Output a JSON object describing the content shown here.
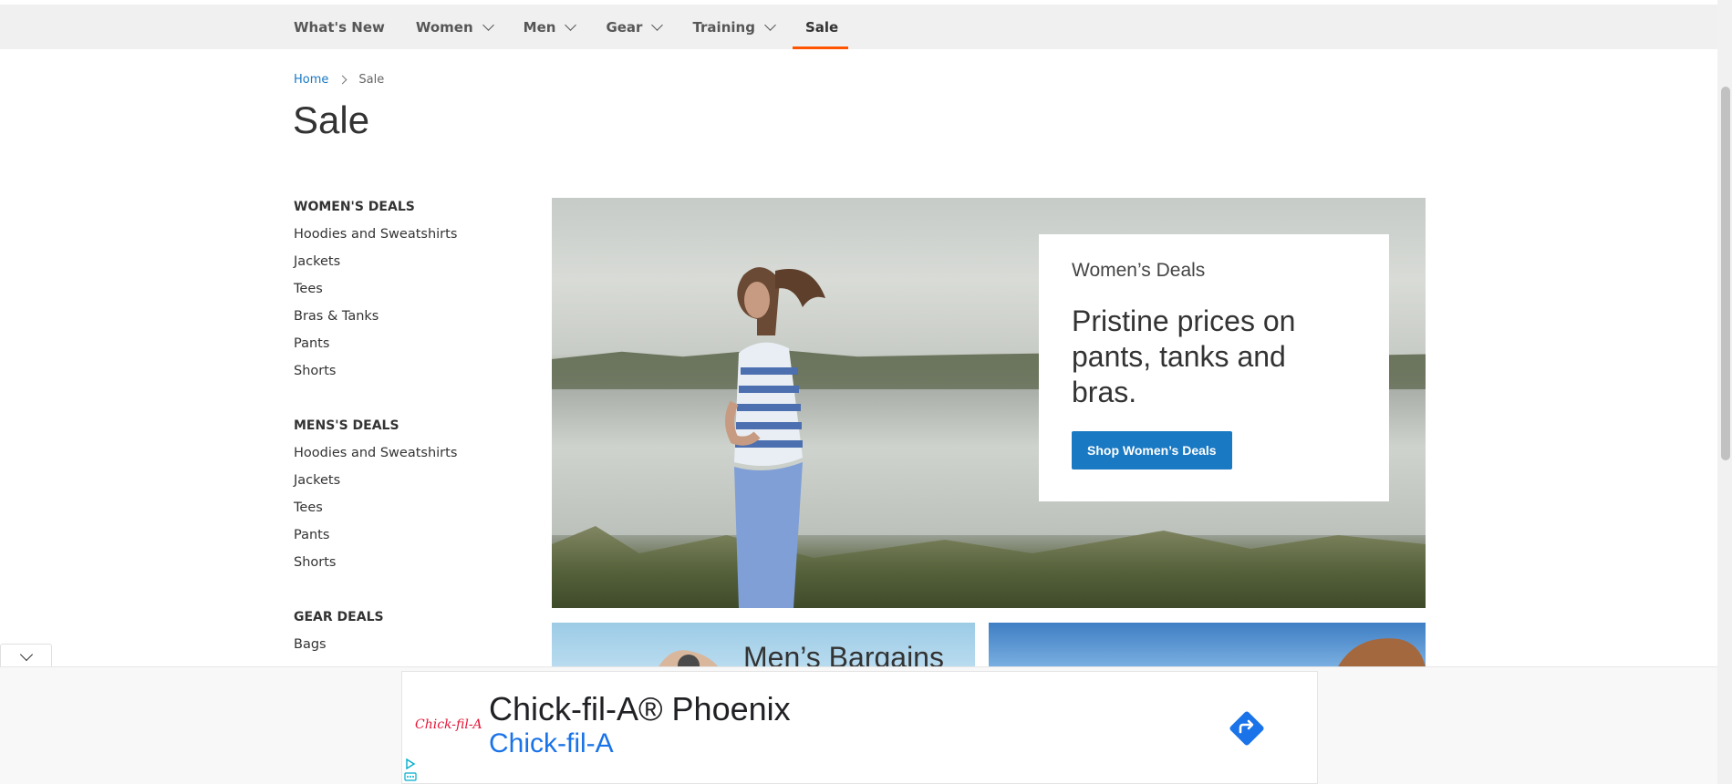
{
  "nav": {
    "items": [
      {
        "label": "What's New",
        "has_dropdown": false
      },
      {
        "label": "Women",
        "has_dropdown": true
      },
      {
        "label": "Men",
        "has_dropdown": true
      },
      {
        "label": "Gear",
        "has_dropdown": true
      },
      {
        "label": "Training",
        "has_dropdown": true
      },
      {
        "label": "Sale",
        "has_dropdown": false,
        "active": true
      }
    ]
  },
  "breadcrumb": {
    "home": "Home",
    "current": "Sale"
  },
  "page_title": "Sale",
  "sidebar": {
    "groups": [
      {
        "heading": "WOMEN'S DEALS",
        "links": [
          "Hoodies and Sweatshirts",
          "Jackets",
          "Tees",
          "Bras & Tanks",
          "Pants",
          "Shorts"
        ]
      },
      {
        "heading": "MENS'S DEALS",
        "links": [
          "Hoodies and Sweatshirts",
          "Jackets",
          "Tees",
          "Pants",
          "Shorts"
        ]
      },
      {
        "heading": "GEAR DEALS",
        "links": [
          "Bags"
        ]
      }
    ]
  },
  "hero": {
    "subtitle": "Women’s Deals",
    "title": "Pristine prices on pants, tanks and bras.",
    "button": "Shop Women’s Deals"
  },
  "tiles": {
    "left_title": "Men’s Bargains"
  },
  "ad": {
    "logo": "Chick-fil-A",
    "title": "Chick-fil-A® Phoenix",
    "subtitle": "Chick-fil-A"
  },
  "colors": {
    "accent": "#ff5501",
    "link": "#1979c3",
    "button": "#1979c3",
    "ad_link": "#1a73e8"
  }
}
